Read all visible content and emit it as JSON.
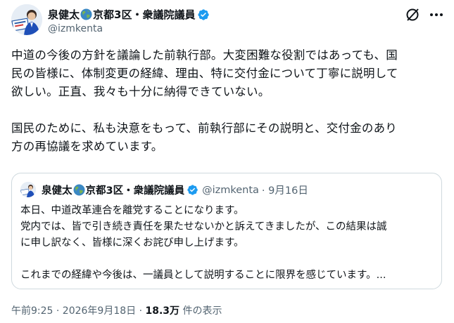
{
  "tweet": {
    "author_name": "泉健太",
    "author_name_suffix": "京都3区・衆議院議員",
    "author_handle": "@izmkenta",
    "body": [
      "中道の今後の方針を議論した前執行部。大変困難な役割ではあっても、国",
      "民の皆様に、体制変更の経緯、理由、特に交付金について丁寧に説明して",
      "欲しい。正直、我々も十分に納得できていない。",
      "国民のために、私も決意をもって、前執行部にその説明と、交付金のあり",
      "方の再協議を求めています。"
    ]
  },
  "quoted": {
    "author_name": "泉健太",
    "author_name_suffix": "京都3区・衆議院議員",
    "author_handle": "@izmkenta",
    "date": "· 9月16日",
    "body": [
      "本日、中道改革連合を離党することになります。",
      "党内では、皆で引き続き責任を果たせないかと訴えてきましたが、この結果は誠",
      "に申し訳なく、皆様に深くお詫び申し上げます。",
      "これまでの経緯や今後は、一議員として説明することに限界を感じています。..."
    ]
  },
  "footer": {
    "time": "午前9:25 · 2026年9月18日 · ",
    "views_count": "18.3万",
    "views_label": " 件の表示"
  },
  "icons": {
    "verified": "verified-badge-icon",
    "globe": "globe-emoji-icon",
    "grok": "grok-icon",
    "more": "more-icon"
  },
  "colors": {
    "text_primary": "#0f1419",
    "text_secondary": "#536471",
    "verified_blue": "#1d9bf0",
    "border": "#cfd9de"
  }
}
